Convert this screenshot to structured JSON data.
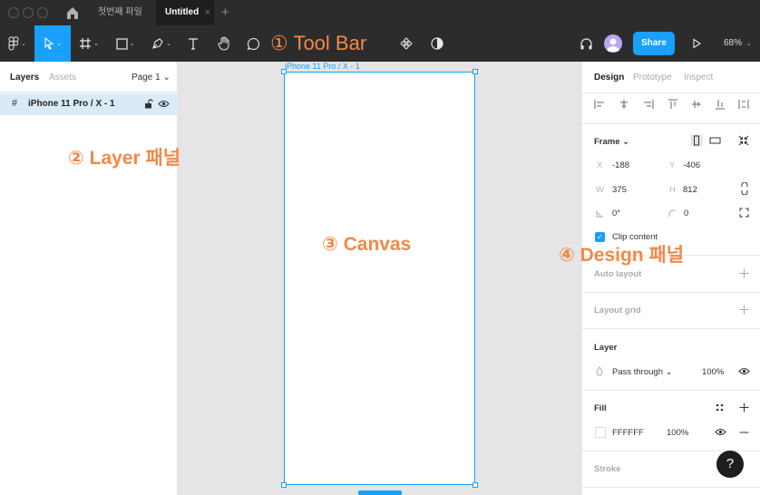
{
  "tabs": {
    "file_tab": "첫번째 파일",
    "active_tab": "Untitled",
    "close_glyph": "×",
    "new_tab_glyph": "+"
  },
  "toolbar": {
    "annotation": "① Tool Bar",
    "share_label": "Share",
    "zoom": "68%",
    "caret": "⌄"
  },
  "left_panel": {
    "tab_layers": "Layers",
    "tab_assets": "Assets",
    "page": "Page 1 ⌄",
    "layer_hash": "#",
    "layer_name": "iPhone 11 Pro / X - 1",
    "annotation": "② Layer 패널"
  },
  "canvas": {
    "frame_label": "iPhone 11 Pro / X - 1",
    "annotation": "③ Canvas"
  },
  "right_panel": {
    "tab_design": "Design",
    "tab_prototype": "Prototype",
    "tab_inspect": "Inspect",
    "frame_title": "Frame ⌄",
    "x_label": "X",
    "x_value": "-188",
    "y_label": "Y",
    "y_value": "-406",
    "w_label": "W",
    "w_value": "375",
    "h_label": "H",
    "h_value": "812",
    "rotation": "0°",
    "radius": "0",
    "clip_content": "Clip content",
    "auto_layout": "Auto layout",
    "layout_grid": "Layout grid",
    "layer_title": "Layer",
    "blend_mode": "Pass through ⌄",
    "layer_opacity": "100%",
    "fill_title": "Fill",
    "fill_hex": "FFFFFF",
    "fill_opacity": "100%",
    "stroke_title": "Stroke",
    "annotation": "④ Design 패널"
  },
  "help_glyph": "?",
  "colors": {
    "accent": "#18a0fb",
    "annotation": "#f1894a",
    "chrome": "#2c2c2c"
  }
}
